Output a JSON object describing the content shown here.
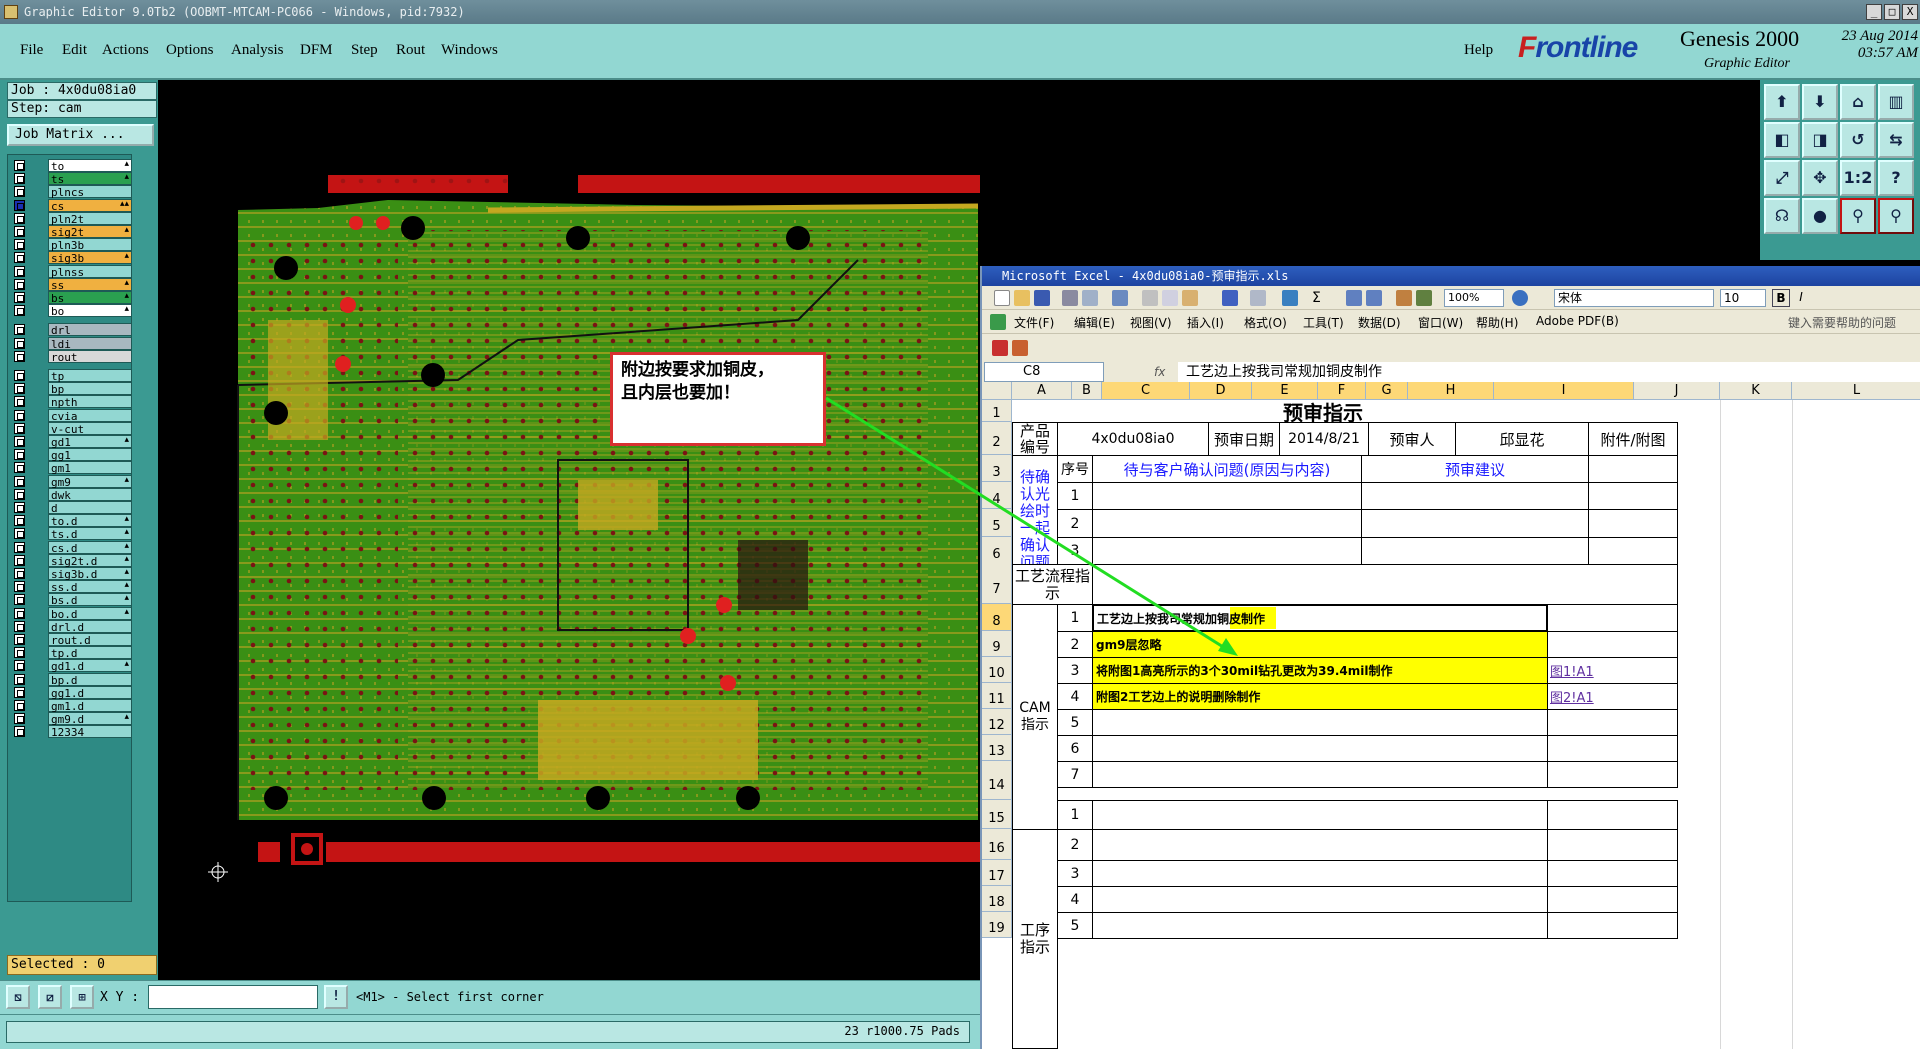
{
  "window": {
    "title": "Graphic Editor 9.0Tb2 (OOBMT-MTCAM-PC066 - Windows, pid:7932)",
    "minimize": "_",
    "maximize": "□",
    "close": "X"
  },
  "menu": {
    "items": [
      "File",
      "Edit",
      "Actions",
      "Options",
      "Analysis",
      "DFM",
      "Step",
      "Rout",
      "Windows"
    ],
    "help": "Help"
  },
  "brand": {
    "frontline_prefix": "F",
    "frontline_rest": "rontline",
    "genesis": "Genesis 2000",
    "subtitle": "Graphic Editor",
    "date": "23 Aug 2014",
    "time": "03:57 AM",
    "frontline_color": "#1844a8",
    "accent_red": "#c82020"
  },
  "job": {
    "job_label": "Job : 4x0du08ia0",
    "step_label": "Step: cam",
    "matrix_button": "Job Matrix ..."
  },
  "layers": [
    {
      "name": "to",
      "color": "#ffffff",
      "mark": "▴"
    },
    {
      "name": "ts",
      "color": "#2aa050",
      "mark": "▴"
    },
    {
      "name": "plncs",
      "color": "#92d7d2",
      "mark": ""
    },
    {
      "name": "cs",
      "color": "#f0b040",
      "mark": "▴▴",
      "active": true
    },
    {
      "name": "pln2t",
      "color": "#92d7d2",
      "mark": ""
    },
    {
      "name": "sig2t",
      "color": "#f0b040",
      "mark": "▴"
    },
    {
      "name": "pln3b",
      "color": "#92d7d2",
      "mark": ""
    },
    {
      "name": "sig3b",
      "color": "#f0b040",
      "mark": "▴"
    },
    {
      "name": "plnss",
      "color": "#92d7d2",
      "mark": ""
    },
    {
      "name": "ss",
      "color": "#f0b040",
      "mark": "▴"
    },
    {
      "name": "bs",
      "color": "#2aa050",
      "mark": "▴"
    },
    {
      "name": "bo",
      "color": "#ffffff",
      "mark": "▴"
    },
    {
      "name": "drl",
      "color": "#a8b8c0",
      "mark": ""
    },
    {
      "name": "ldi",
      "color": "#a8b8c0",
      "mark": ""
    },
    {
      "name": "rout",
      "color": "#d8d8d8",
      "mark": ""
    },
    {
      "name": "tp",
      "color": "#92d7d2",
      "mark": ""
    },
    {
      "name": "bp",
      "color": "#92d7d2",
      "mark": ""
    },
    {
      "name": "npth",
      "color": "#92d7d2",
      "mark": ""
    },
    {
      "name": "cvia",
      "color": "#92d7d2",
      "mark": ""
    },
    {
      "name": "v-cut",
      "color": "#92d7d2",
      "mark": ""
    },
    {
      "name": "gd1",
      "color": "#92d7d2",
      "mark": "▴"
    },
    {
      "name": "gg1",
      "color": "#92d7d2",
      "mark": ""
    },
    {
      "name": "gm1",
      "color": "#92d7d2",
      "mark": ""
    },
    {
      "name": "gm9",
      "color": "#92d7d2",
      "mark": "▴"
    },
    {
      "name": "dwk",
      "color": "#92d7d2",
      "mark": ""
    },
    {
      "name": "d",
      "color": "#92d7d2",
      "mark": ""
    },
    {
      "name": "to.d",
      "color": "#92d7d2",
      "mark": "▴"
    },
    {
      "name": "ts.d",
      "color": "#92d7d2",
      "mark": "▴"
    },
    {
      "name": "cs.d",
      "color": "#92d7d2",
      "mark": "▴"
    },
    {
      "name": "sig2t.d",
      "color": "#92d7d2",
      "mark": "▴"
    },
    {
      "name": "sig3b.d",
      "color": "#92d7d2",
      "mark": "▴"
    },
    {
      "name": "ss.d",
      "color": "#92d7d2",
      "mark": "▴"
    },
    {
      "name": "bs.d",
      "color": "#92d7d2",
      "mark": "▴"
    },
    {
      "name": "bo.d",
      "color": "#92d7d2",
      "mark": "▴"
    },
    {
      "name": "drl.d",
      "color": "#92d7d2",
      "mark": ""
    },
    {
      "name": "rout.d",
      "color": "#92d7d2",
      "mark": ""
    },
    {
      "name": "tp.d",
      "color": "#92d7d2",
      "mark": ""
    },
    {
      "name": "gd1.d",
      "color": "#92d7d2",
      "mark": "▴"
    },
    {
      "name": "bp.d",
      "color": "#92d7d2",
      "mark": ""
    },
    {
      "name": "gg1.d",
      "color": "#92d7d2",
      "mark": ""
    },
    {
      "name": "gm1.d",
      "color": "#92d7d2",
      "mark": ""
    },
    {
      "name": "gm9.d",
      "color": "#92d7d2",
      "mark": "▴"
    },
    {
      "name": "12334",
      "color": "#92d7d2",
      "mark": ""
    }
  ],
  "selected_label": "Selected : 0",
  "bottom": {
    "xy_label": "X Y :",
    "xy_value": "",
    "prompt": "<M1> - Select first corner",
    "status": "23 r1000.75 Pads"
  },
  "callout": {
    "line1": "附边按要求加铜皮，",
    "line2": "且内层也要加！"
  },
  "excel": {
    "title": "Microsoft Excel - 4x0du08ia0-预审指示.xls",
    "menus": [
      "文件(F)",
      "编辑(E)",
      "视图(V)",
      "插入(I)",
      "格式(O)",
      "工具(T)",
      "数据(D)",
      "窗口(W)",
      "帮助(H)",
      "Adobe PDF(B)"
    ],
    "help_placeholder": "键入需要帮助的问题",
    "zoom": "100%",
    "font": "宋体",
    "font_size": "10",
    "bold_btn": "B",
    "italic_btn": "I",
    "name_box": "C8",
    "fx": "fx",
    "formula": "工艺边上按我司常规加铜皮制作",
    "columns": [
      "A",
      "B",
      "C",
      "D",
      "E",
      "F",
      "G",
      "H",
      "I",
      "J",
      "K",
      "L"
    ],
    "rows": [
      "1",
      "2",
      "3",
      "4",
      "5",
      "6",
      "7",
      "8",
      "9",
      "10",
      "11",
      "12",
      "13",
      "14",
      "15",
      "16",
      "17",
      "18",
      "19"
    ],
    "cells": {
      "title": "预审指示",
      "product_no_label": "产品编号",
      "product_no": "4x0du08ia0",
      "review_date_label": "预审日期",
      "review_date": "2014/8/21",
      "reviewer_label": "预审人",
      "reviewer": "邱显花",
      "attachment_label": "附件/附图",
      "seq_label": "序号",
      "confirm_header": "待与客户确认问题(原因与内容)",
      "suggest_header": "预审建议",
      "pending_label": "待确认光绘时一起确认问题",
      "flow_label": "工艺流程指示",
      "cam_label": "CAM指示",
      "process_label": "工序指示",
      "confirm_nums": [
        "1",
        "2",
        "3"
      ],
      "cam_nums": [
        "1",
        "2",
        "3",
        "4",
        "5",
        "6",
        "7"
      ],
      "process_nums": [
        "1",
        "2",
        "3",
        "4",
        "5"
      ],
      "cam_items": [
        "工艺边上按我司常规加铜皮制作",
        "gm9层忽略",
        "将附图1高亮所示的3个30mil钻孔更改为39.4mil制作",
        "附图2工艺边上的说明删除制作"
      ],
      "link1": "图1!A1",
      "link2": "图2!A1"
    }
  }
}
